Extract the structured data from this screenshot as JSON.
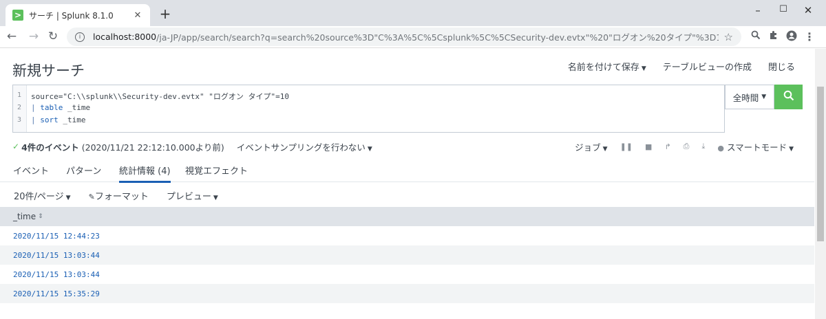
{
  "browser": {
    "tab_title": "サーチ | Splunk 8.1.0",
    "favicon_glyph": ">",
    "url_host": "localhost:8000",
    "url_path": "/ja-JP/app/search/search?q=search%20source%3D\"C%3A%5C%5Csplunk%5C%5CSecurity-dev.evtx\"%20\"ログオン%20タイプ\"%3D10%0A%7C%20table%2..."
  },
  "header": {
    "title": "新規サーチ",
    "save_as": "名前を付けて保存",
    "create_table_view": "テーブルビューの作成",
    "close": "閉じる"
  },
  "search": {
    "lines": [
      {
        "num": "1",
        "text": "source=\"C:\\\\splunk\\\\Security-dev.evtx\" \"ログオン タイプ\"=10"
      },
      {
        "num": "2",
        "pipe": "|",
        "cmd": "table",
        "arg": " _time"
      },
      {
        "num": "3",
        "pipe": "|",
        "cmd": "sort",
        "arg": " _time"
      }
    ],
    "time_range": "全時間"
  },
  "status": {
    "event_count": "4件のイベント",
    "time_info": "(2020/11/21 22:12:10.000より前)",
    "sampling": "イベントサンプリングを行わない",
    "job": "ジョブ",
    "mode": "スマートモード"
  },
  "tabs": [
    "イベント",
    "パターン",
    "統計情報 (4)",
    "視覚エフェクト"
  ],
  "options": {
    "per_page": "20件/ページ",
    "format": "フォーマット",
    "preview": "プレビュー"
  },
  "table": {
    "header": "_time",
    "rows": [
      "2020/11/15 12:44:23",
      "2020/11/15 13:03:44",
      "2020/11/15 13:03:44",
      "2020/11/15 15:35:29"
    ]
  },
  "colors": {
    "accent_green": "#5cc05c",
    "link_blue": "#1a5fb4"
  }
}
